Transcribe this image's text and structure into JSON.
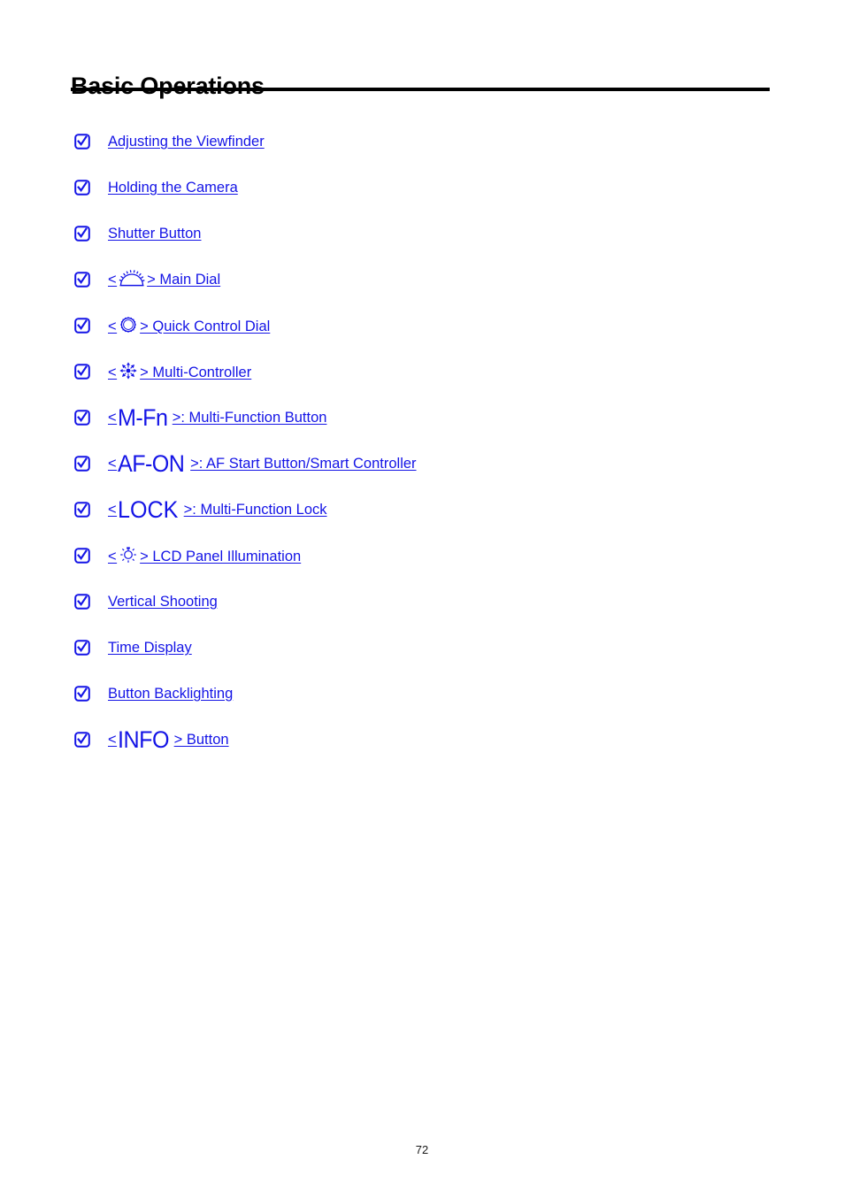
{
  "document": {
    "title": "Basic Operations",
    "page_number": "72",
    "link_color": "#1414e6",
    "text_color": "#000000"
  },
  "toc": {
    "bullet_icon": "checkbox-checked-icon",
    "items": [
      {
        "id": "adjusting-the-viewfinder",
        "prefix": "",
        "icon": "",
        "legend": "",
        "label": "Adjusting the Viewfinder",
        "suffix": ""
      },
      {
        "id": "holding-the-camera",
        "prefix": "",
        "icon": "",
        "legend": "",
        "label": "Holding the Camera",
        "suffix": ""
      },
      {
        "id": "shutter-button",
        "prefix": "",
        "icon": "",
        "legend": "",
        "label": "Shutter Button",
        "suffix": ""
      },
      {
        "id": "main-dial",
        "prefix": "<",
        "icon": "main-dial-icon",
        "legend": "",
        "label": "> Main Dial",
        "suffix": ""
      },
      {
        "id": "quick-control-dial",
        "prefix": "<",
        "icon": "quick-control-dial-icon",
        "legend": "",
        "label": "> Quick Control Dial",
        "suffix": ""
      },
      {
        "id": "multi-controller",
        "prefix": "<",
        "icon": "multi-controller-icon",
        "legend": "",
        "label": "> Multi-Controller",
        "suffix": ""
      },
      {
        "id": "multi-function-button",
        "prefix": "<",
        "icon": "",
        "legend": "M-Fn",
        "label": ">: Multi-Function Button",
        "suffix": ""
      },
      {
        "id": "af-start-button-smart-controller",
        "prefix": "<",
        "icon": "",
        "legend": "AF-ON",
        "label": ">: AF Start Button/Smart Controller",
        "suffix": ""
      },
      {
        "id": "multi-function-lock",
        "prefix": "<",
        "icon": "",
        "legend": "LOCK",
        "label": ">: Multi-Function Lock",
        "suffix": ""
      },
      {
        "id": "lcd-panel-illumination",
        "prefix": "<",
        "icon": "lcd-illumination-icon",
        "legend": "",
        "label": "> LCD Panel Illumination",
        "suffix": ""
      },
      {
        "id": "vertical-shooting",
        "prefix": "",
        "icon": "",
        "legend": "",
        "label": "Vertical Shooting",
        "suffix": ""
      },
      {
        "id": "time-display",
        "prefix": "",
        "icon": "",
        "legend": "",
        "label": "Time Display",
        "suffix": ""
      },
      {
        "id": "button-backlighting",
        "prefix": "",
        "icon": "",
        "legend": "",
        "label": "Button Backlighting",
        "suffix": ""
      },
      {
        "id": "info-button",
        "prefix": "<",
        "icon": "",
        "legend": "INFO",
        "label": "> Button",
        "suffix": ""
      }
    ]
  }
}
